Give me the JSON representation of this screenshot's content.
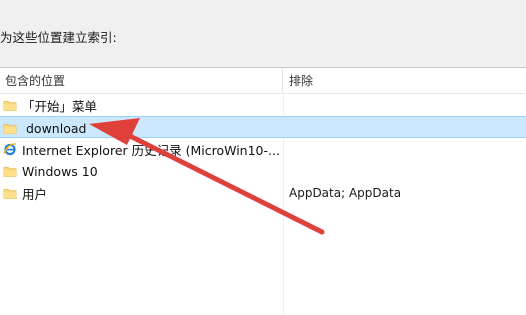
{
  "instruction": "为这些位置建立索引:",
  "columns": {
    "included": "包含的位置",
    "exclude": "排除"
  },
  "rows": [
    {
      "name": "「开始」菜单",
      "exclude": "",
      "icon": "folder-icon"
    },
    {
      "name": "download",
      "exclude": "",
      "icon": "folder-icon"
    },
    {
      "name": "Internet Explorer 历史记录 (MicroWin10-...",
      "exclude": "",
      "icon": "internet-explorer-icon"
    },
    {
      "name": "Windows 10",
      "exclude": "",
      "icon": "folder-icon"
    },
    {
      "name": "用户",
      "exclude": "AppData; AppData",
      "icon": "folder-icon"
    }
  ],
  "colors": {
    "selection": "#cce8ff",
    "folder": "#f8d775",
    "annotation_arrow": "#e0403a"
  }
}
